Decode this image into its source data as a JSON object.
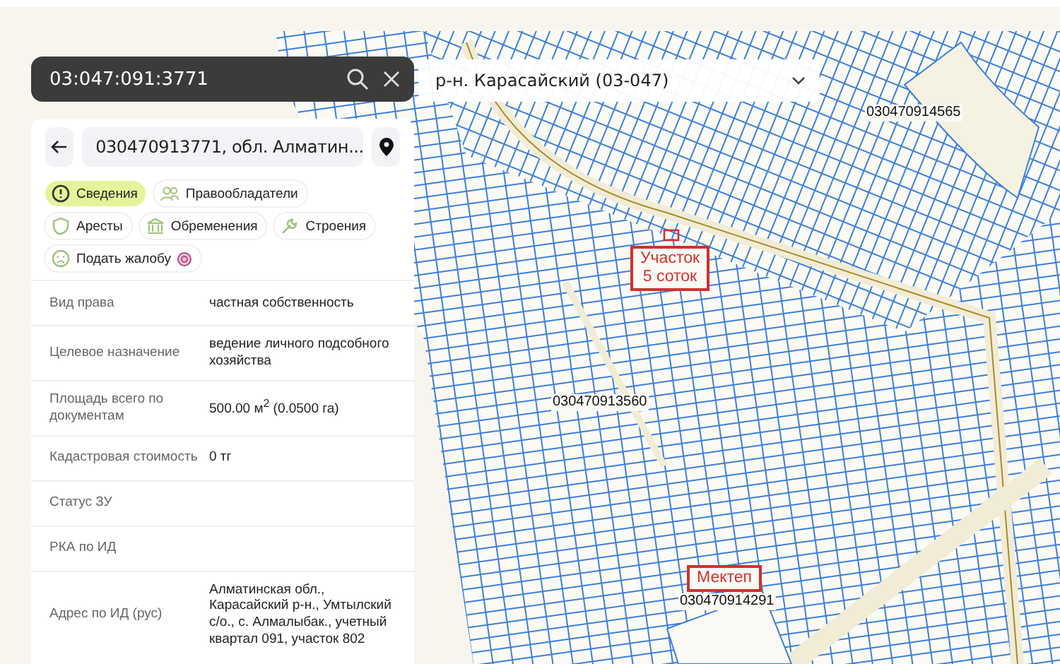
{
  "search": {
    "value": "03:047:091:3771"
  },
  "region_select": {
    "value": "р-н. Карасайский (03-047)"
  },
  "panel": {
    "title": "030470913771, обл. Алматин...",
    "tabs": [
      {
        "label": "Сведения",
        "selected": true
      },
      {
        "label": "Правообладатели",
        "selected": false
      },
      {
        "label": "Аресты",
        "selected": false
      },
      {
        "label": "Обременения",
        "selected": false
      },
      {
        "label": "Строения",
        "selected": false
      },
      {
        "label": "Подать жалобу",
        "selected": false
      }
    ],
    "rows": [
      {
        "label": "Вид права",
        "value": "частная собственность"
      },
      {
        "label": "Целевое назначение",
        "value": "ведение личного подсобного хозяйства"
      },
      {
        "label": "Площадь всего по документам",
        "value": "500.00 м$^{2}$ (0.0500 га)"
      },
      {
        "label": "Кадастровая стоимость",
        "value": "0 тг"
      },
      {
        "label": "Статус ЗУ",
        "value": ""
      },
      {
        "label": "РКА по ИД",
        "value": ""
      },
      {
        "label": "Адрес по ИД (рус)",
        "value": "Алматинская обл., Карасайский р-н., Умтылский с/о., с. Алмалыбак., учетный квартал 091, участок 802"
      }
    ]
  },
  "map": {
    "labels": [
      {
        "kind": "number",
        "text": "030470914565"
      },
      {
        "kind": "callout",
        "text": "Участок\n5 соток"
      },
      {
        "kind": "number",
        "text": "030470913560"
      },
      {
        "kind": "callout",
        "text": "Мектеп"
      },
      {
        "kind": "number",
        "text": "030470914291"
      }
    ]
  }
}
